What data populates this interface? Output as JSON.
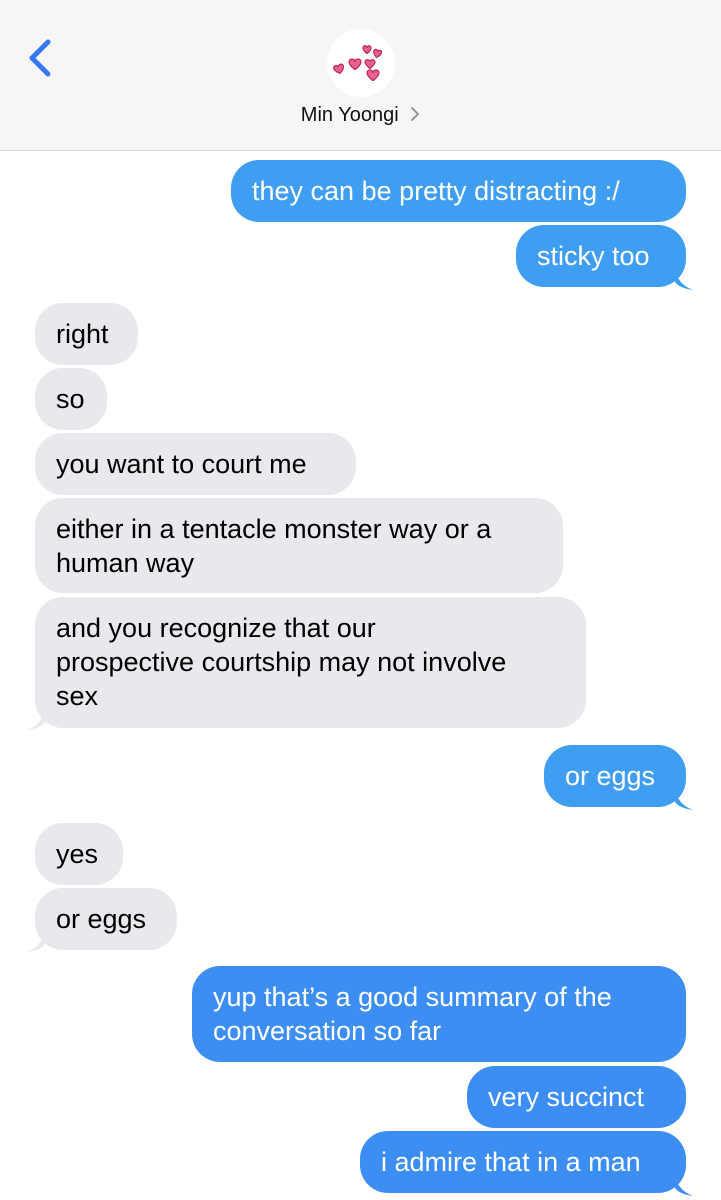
{
  "header": {
    "contact_name": "Min Yoongi",
    "back_icon": "chevron-left-icon",
    "avatar_icon": "hearts-icon",
    "accent_color": "#3478f6"
  },
  "colors": {
    "sent_top": "#3f9ef2",
    "sent_bottom": "#3d8ef2",
    "received": "#e8e8ed"
  },
  "messages": [
    {
      "from": "me",
      "text": "they can be pretty distracting :/"
    },
    {
      "from": "me",
      "text": "sticky too"
    },
    {
      "from": "them",
      "text": "right"
    },
    {
      "from": "them",
      "text": "so"
    },
    {
      "from": "them",
      "text": "you want to court me"
    },
    {
      "from": "them",
      "text": "either in a tentacle monster way or a",
      "text2": "human way"
    },
    {
      "from": "them",
      "text": "and you recognize that our",
      "text2": "prospective courtship may not involve",
      "text3": "sex"
    },
    {
      "from": "me",
      "text": "or eggs"
    },
    {
      "from": "them",
      "text": "yes"
    },
    {
      "from": "them",
      "text": "or eggs"
    },
    {
      "from": "me",
      "text": "yup that’s a good summary of the",
      "text2": "conversation so far"
    },
    {
      "from": "me",
      "text": "very succinct"
    },
    {
      "from": "me",
      "text": "i admire that in a man"
    }
  ]
}
